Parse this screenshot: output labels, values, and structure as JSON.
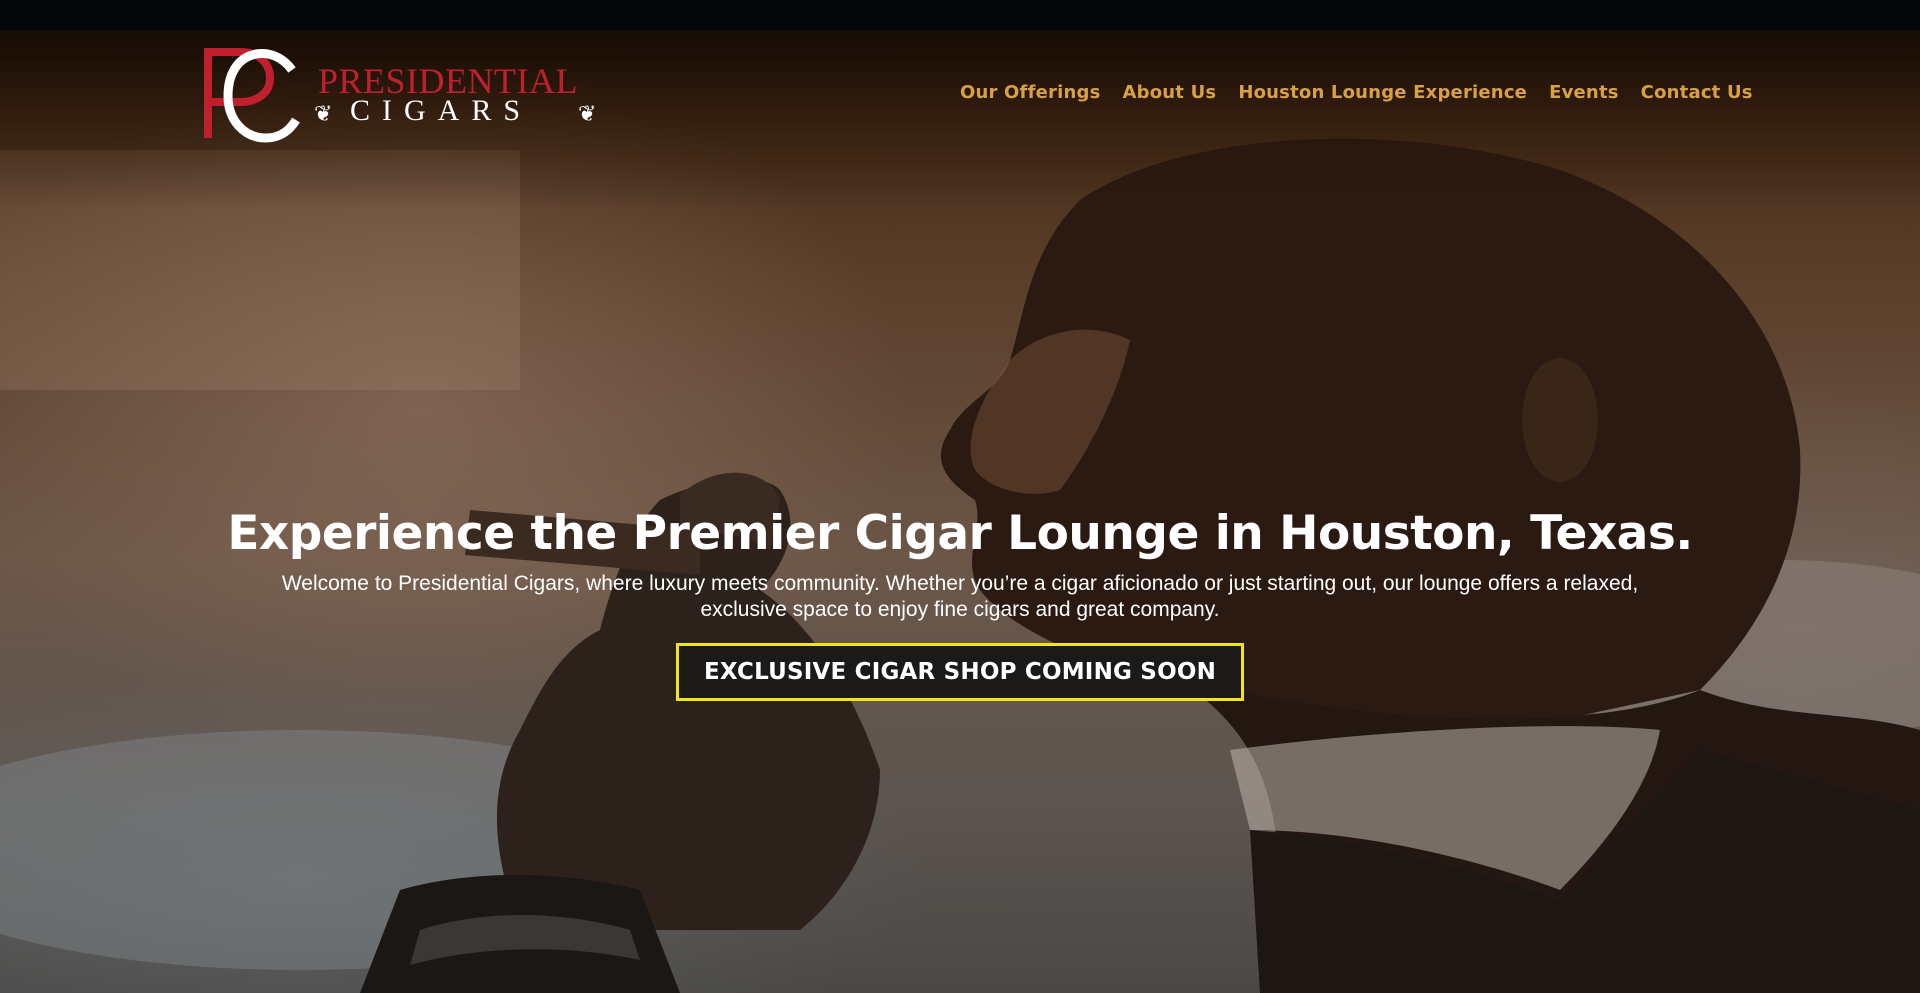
{
  "logo": {
    "monogram_first": "P",
    "monogram_second": "C",
    "word_top": "PRESIDENTIAL",
    "word_bottom": "CIGARS"
  },
  "nav": {
    "items": [
      {
        "label": "Our Offerings"
      },
      {
        "label": "About Us"
      },
      {
        "label": "Houston Lounge Experience"
      },
      {
        "label": "Events"
      },
      {
        "label": "Contact Us"
      }
    ]
  },
  "hero": {
    "title": "Experience the Premier Cigar Lounge in Houston, Texas.",
    "subtitle": "Welcome to Presidential Cigars, where luxury meets community. Whether you’re a cigar aficionado or just starting out, our lounge offers a relaxed, exclusive space to enjoy fine cigars and great company.",
    "cta_label": "EXCLUSIVE CIGAR SHOP COMING SOON",
    "image": "man-smoking-cigar-photo"
  },
  "colors": {
    "nav_text": "#d9a044",
    "logo_red": "#c0202e",
    "cta_border": "#f2e61a",
    "cta_bg": "#1c1a18"
  }
}
